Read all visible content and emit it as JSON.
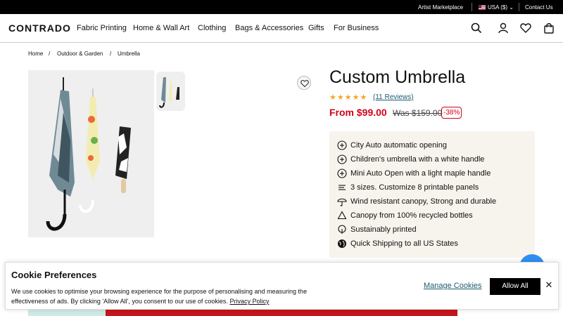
{
  "topbar": {
    "artist_marketplace": "Artist Marketplace",
    "currency": "USA ($)",
    "contact": "Contact Us"
  },
  "header": {
    "logo": "CONTRADO",
    "nav": [
      "Fabric Printing",
      "Home & Wall Art",
      "Clothing",
      "Bags & Accessories",
      "Gifts",
      "For Business"
    ],
    "icons": [
      "search-icon",
      "user-icon",
      "heart-icon",
      "bag-icon"
    ]
  },
  "breadcrumb": {
    "home": "Home",
    "category": "Outdoor & Garden",
    "current": "Umbrella",
    "separator": "/"
  },
  "product": {
    "title": "Custom Umbrella",
    "rating_stars": 5,
    "stars_glyphs": "★★★★★",
    "reviews": "(11 Reviews)",
    "price": "From $99.00",
    "was_price": "Was $159.00",
    "discount": "-38%",
    "features": [
      {
        "icon": "plus-circle-icon",
        "text": "City Auto automatic opening"
      },
      {
        "icon": "plus-circle-icon",
        "text": "Children's umbrella with a white handle"
      },
      {
        "icon": "plus-circle-icon",
        "text": "Mini Auto Open with a light maple handle"
      },
      {
        "icon": "ruler-icon",
        "text": "3 sizes. Customize 8 printable panels"
      },
      {
        "icon": "umbrella-icon",
        "text": "Wind resistant canopy, Strong and durable"
      },
      {
        "icon": "recycle-icon",
        "text": "Canopy from 100% recycled bottles"
      },
      {
        "icon": "leaf-icon",
        "text": "Sustainably printed"
      },
      {
        "icon": "globe-icon",
        "text": "Quick Shipping to all US States"
      }
    ]
  },
  "cookie": {
    "title": "Cookie Preferences",
    "text": "We use cookies to optimise your browsing experience for the purpose of personalising and measuring the effectiveness of ads. By clicking 'Allow All', you consent to our use of cookies.",
    "policy_link": "Privacy Policy",
    "manage": "Manage Cookies",
    "allow": "Allow All",
    "close": "✕"
  },
  "colors": {
    "price_red": "#d0021b",
    "star": "#f5a623",
    "link": "#1a5b6e",
    "feature_bg": "#f7f3ed",
    "chat_blue": "#2f8ff0"
  }
}
